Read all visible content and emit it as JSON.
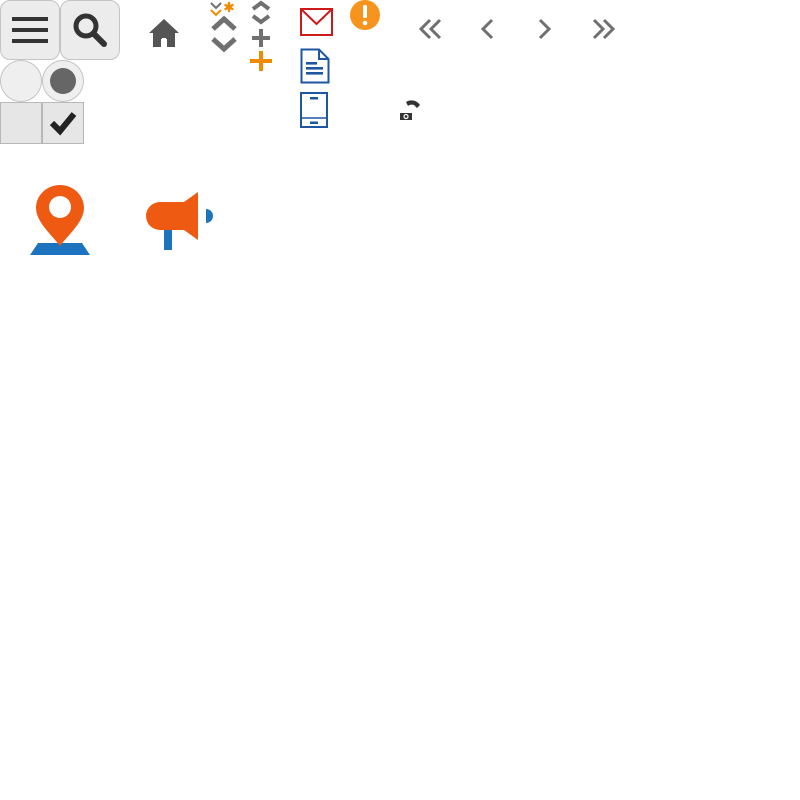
{
  "icons": {
    "menu": "menu-icon",
    "search": "search-icon",
    "home": "home-icon",
    "sort_asterisk": "sort-asterisk-icon",
    "sort": "sort-icon",
    "sort_add": "sort-add-icon",
    "add": "plus-icon",
    "mail": "mail-icon",
    "alert": "alert-icon",
    "document": "document-icon",
    "mobile": "mobile-icon",
    "phone_camera": "phone-camera-icon",
    "first_page": "first-page-icon",
    "previous_page": "previous-page-icon",
    "next_page": "next-page-icon",
    "last_page": "last-page-icon",
    "radio_off": "radio-unselected-icon",
    "radio_on": "radio-selected-icon",
    "checkbox_off": "checkbox-unchecked-icon",
    "checkbox_on": "checkbox-checked-icon",
    "map_pin": "map-pin-icon",
    "megaphone": "megaphone-icon"
  },
  "colors": {
    "tile_bg": "#ececec",
    "tile_border": "#c4c4c4",
    "dark_gray": "#333333",
    "mid_gray": "#707070",
    "orange": "#f08a00",
    "alert_orange": "#f7941d",
    "red": "#cc1a1a",
    "blue": "#1e56a0",
    "brand_orange": "#ef5a12",
    "brand_blue": "#1e73be"
  },
  "state": {
    "radio_selected": true,
    "checkbox_checked": true
  }
}
